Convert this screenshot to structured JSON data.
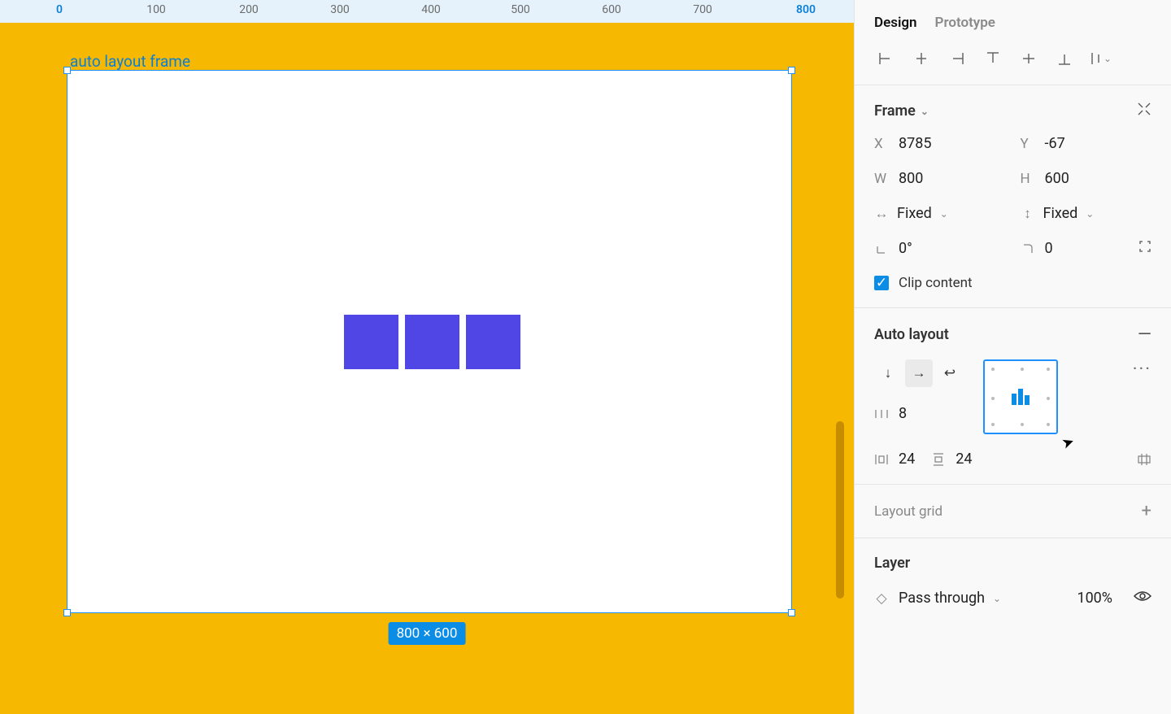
{
  "canvas": {
    "ruler_ticks": [
      {
        "label": "0",
        "pos": 73,
        "active": true
      },
      {
        "label": "100",
        "pos": 192,
        "active": false
      },
      {
        "label": "200",
        "pos": 306,
        "active": false
      },
      {
        "label": "300",
        "pos": 418,
        "active": false
      },
      {
        "label": "400",
        "pos": 530,
        "active": false
      },
      {
        "label": "500",
        "pos": 640,
        "active": false
      },
      {
        "label": "600",
        "pos": 752,
        "active": false
      },
      {
        "label": "700",
        "pos": 864,
        "active": false
      },
      {
        "label": "800",
        "pos": 991,
        "active": true
      }
    ],
    "frame_label": "auto layout frame",
    "dimensions_badge": "800 × 600"
  },
  "tabs": {
    "design": "Design",
    "prototype": "Prototype"
  },
  "frame": {
    "title": "Frame",
    "x_label": "X",
    "x_value": "8785",
    "y_label": "Y",
    "y_value": "-67",
    "w_label": "W",
    "w_value": "800",
    "h_label": "H",
    "h_value": "600",
    "resize_w": "Fixed",
    "resize_h": "Fixed",
    "rotation": "0°",
    "radius": "0",
    "clip_label": "Clip content"
  },
  "autolayout": {
    "title": "Auto layout",
    "gap": "8",
    "pad_h": "24",
    "pad_v": "24"
  },
  "layout_grid": {
    "title": "Layout grid"
  },
  "layer": {
    "title": "Layer",
    "blend": "Pass through",
    "opacity": "100%"
  }
}
